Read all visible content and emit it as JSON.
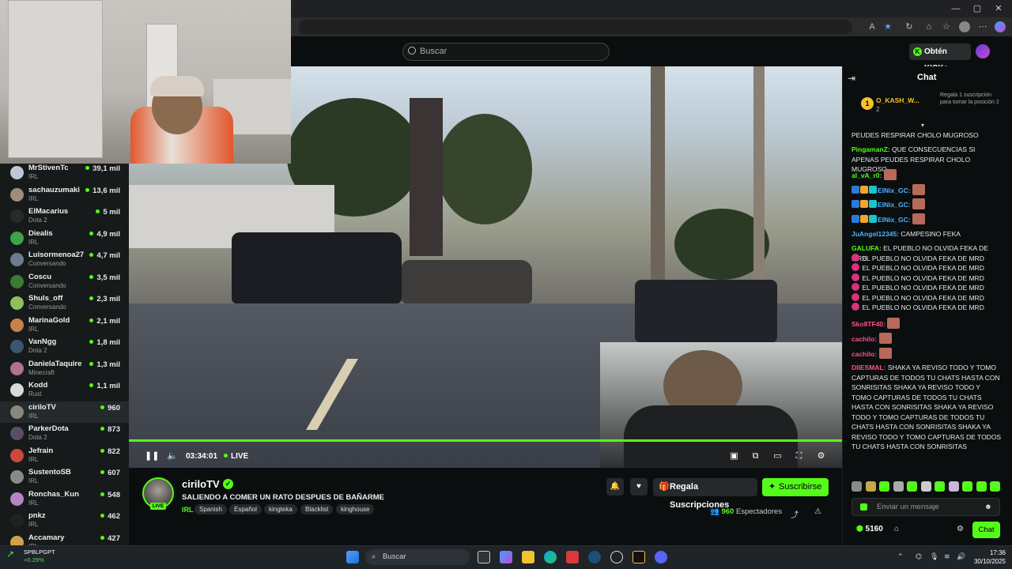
{
  "header": {
    "search_placeholder": "Buscar",
    "kicks_label": "Obtén KICKs"
  },
  "sidebar": {
    "channels": [
      {
        "name": "MrStivenTc",
        "category": "IRL",
        "viewers": "39,1 mil",
        "color": "#c0c7d4"
      },
      {
        "name": "sachauzumaki",
        "category": "IRL",
        "viewers": "13,6 mil",
        "color": "#9d8d7a"
      },
      {
        "name": "ElMacarius",
        "category": "Dota 2",
        "viewers": "5 mil",
        "color": "#2a2a2a"
      },
      {
        "name": "Diealis",
        "category": "IRL",
        "viewers": "4,9 mil",
        "color": "#3fa34a"
      },
      {
        "name": "Luisormenoa27",
        "category": "Conversando",
        "viewers": "4,7 mil",
        "color": "#6e7b8e"
      },
      {
        "name": "Coscu",
        "category": "Conversando",
        "viewers": "3,5 mil",
        "color": "#3c7a35"
      },
      {
        "name": "Shuls_off",
        "category": "Conversando",
        "viewers": "2,3 mil",
        "color": "#8fbf5a"
      },
      {
        "name": "MarinaGold",
        "category": "IRL",
        "viewers": "2,1 mil",
        "color": "#c7824a"
      },
      {
        "name": "VanNgg",
        "category": "Dota 2",
        "viewers": "1,8 mil",
        "color": "#3a5670"
      },
      {
        "name": "DanielaTaquire",
        "category": "Minecraft",
        "viewers": "1,3 mil",
        "color": "#b0738f"
      },
      {
        "name": "Kodd",
        "category": "Rust",
        "viewers": "1,1 mil",
        "color": "#d9d9d9"
      },
      {
        "name": "ciriloTV",
        "category": "IRL",
        "viewers": "960",
        "color": "#8a8680"
      },
      {
        "name": "ParkerDota",
        "category": "Dota 2",
        "viewers": "873",
        "color": "#5b4f66"
      },
      {
        "name": "Jefrain",
        "category": "IRL",
        "viewers": "822",
        "color": "#c94a3a"
      },
      {
        "name": "SustentoSB",
        "category": "IRL",
        "viewers": "607",
        "color": "#8a8a8a"
      },
      {
        "name": "Ronchas_Kun",
        "category": "IRL",
        "viewers": "548",
        "color": "#b583c4"
      },
      {
        "name": "pnkz",
        "category": "IRL",
        "viewers": "462",
        "color": "#222222"
      },
      {
        "name": "Accamary",
        "category": "IRL",
        "viewers": "427",
        "color": "#d4a14a"
      }
    ]
  },
  "player": {
    "time": "03:34:01",
    "live_label": "LIVE"
  },
  "stream": {
    "channel_name": "ciriloTV",
    "live_tag": "LIVE",
    "title": "SALIENDO A COMER UN RATO DESPUES DE BAÑARME",
    "category": "IRL",
    "tags": [
      "Spanish",
      "Español",
      "kingteka",
      "Blacklist",
      "kinghouse"
    ],
    "gift_label": "Regala Suscripciones",
    "subscribe_label": "Suscribirse",
    "viewer_count": "960",
    "viewer_label": "Espectadores"
  },
  "chat": {
    "title": "Chat",
    "pinned": {
      "rank": "1",
      "user": "O_KASH_W...",
      "count": "2",
      "cta": "Regala 1 suscripción para tomar la posición 2"
    },
    "messages": [
      {
        "user": "",
        "text": "PEUDES RESPIRAR CHOLO MUGROSO",
        "color": "#e8e8e8"
      },
      {
        "user": "PingamanZ:",
        "text": "QUE CONSECUENCIAS SI APENAS PEUDES RESPIRAR CHOLO MUGROSO",
        "color": "#53fc18"
      },
      {
        "user": "al_vA_r0:",
        "text": "",
        "color": "#53fc18"
      },
      {
        "user": "ElNix_GC:",
        "text": "",
        "color": "#4fb3ff"
      },
      {
        "user": "ElNix_GC:",
        "text": "",
        "color": "#4fb3ff"
      },
      {
        "user": "ElNix_GC:",
        "text": "",
        "color": "#4fb3ff"
      },
      {
        "user": "JuAngel12345:",
        "text": "CAMPESINO FEKA",
        "color": "#4fb3ff"
      },
      {
        "user": "GALUFA:",
        "text": "EL PUEBLO NO OLVIDA FEKA DE MRD",
        "color": "#53fc18"
      },
      {
        "user": "",
        "text": "EL PUEBLO NO OLVIDA FEKA DE MRD",
        "color": "#e8e8e8"
      },
      {
        "user": "",
        "text": "EL PUEBLO NO OLVIDA FEKA DE MRD",
        "color": "#e8e8e8"
      },
      {
        "user": "",
        "text": "EL PUEBLO NO OLVIDA FEKA DE MRD",
        "color": "#e8e8e8"
      },
      {
        "user": "",
        "text": "EL PUEBLO NO OLVIDA FEKA DE MRD",
        "color": "#e8e8e8"
      },
      {
        "user": "",
        "text": "EL PUEBLO NO OLVIDA FEKA DE MRD",
        "color": "#e8e8e8"
      },
      {
        "user": "",
        "text": "EL PUEBLO NO OLVIDA FEKA DE MRD",
        "color": "#e8e8e8"
      },
      {
        "user": "Sko8TF40:",
        "text": "",
        "color": "#ff4f8b"
      },
      {
        "user": "cachilo:",
        "text": "",
        "color": "#ff4f8b"
      },
      {
        "user": "cachilo:",
        "text": "",
        "color": "#ff4f8b"
      },
      {
        "user": "DIIESMAL:",
        "text": "SHAKA YA REVISO TODO Y TOMO CAPTURAS DE TODOS TU CHATS HASTA CON SONRISITAS SHAKA YA REVISO TODO Y TOMO CAPTURAS DE TODOS TU CHATS HASTA CON SONRISITAS SHAKA YA REVISO TODO Y TOMO CAPTURAS DE TODOS TU CHATS HASTA CON SONRISITAS SHAKA YA REVISO TODO Y TOMO CAPTURAS DE TODOS TU CHATS HASTA CON SONRISITAS",
        "color": "#ff4f8b"
      }
    ],
    "input_placeholder": "Enviar un mensaje",
    "points": "5160",
    "send_label": "Chat"
  },
  "taskbar": {
    "ticker_symbol": "SPBLPGPT",
    "ticker_change": "+0.29%",
    "search_placeholder": "Buscar",
    "time": "17:36",
    "date": "30/10/2025"
  }
}
